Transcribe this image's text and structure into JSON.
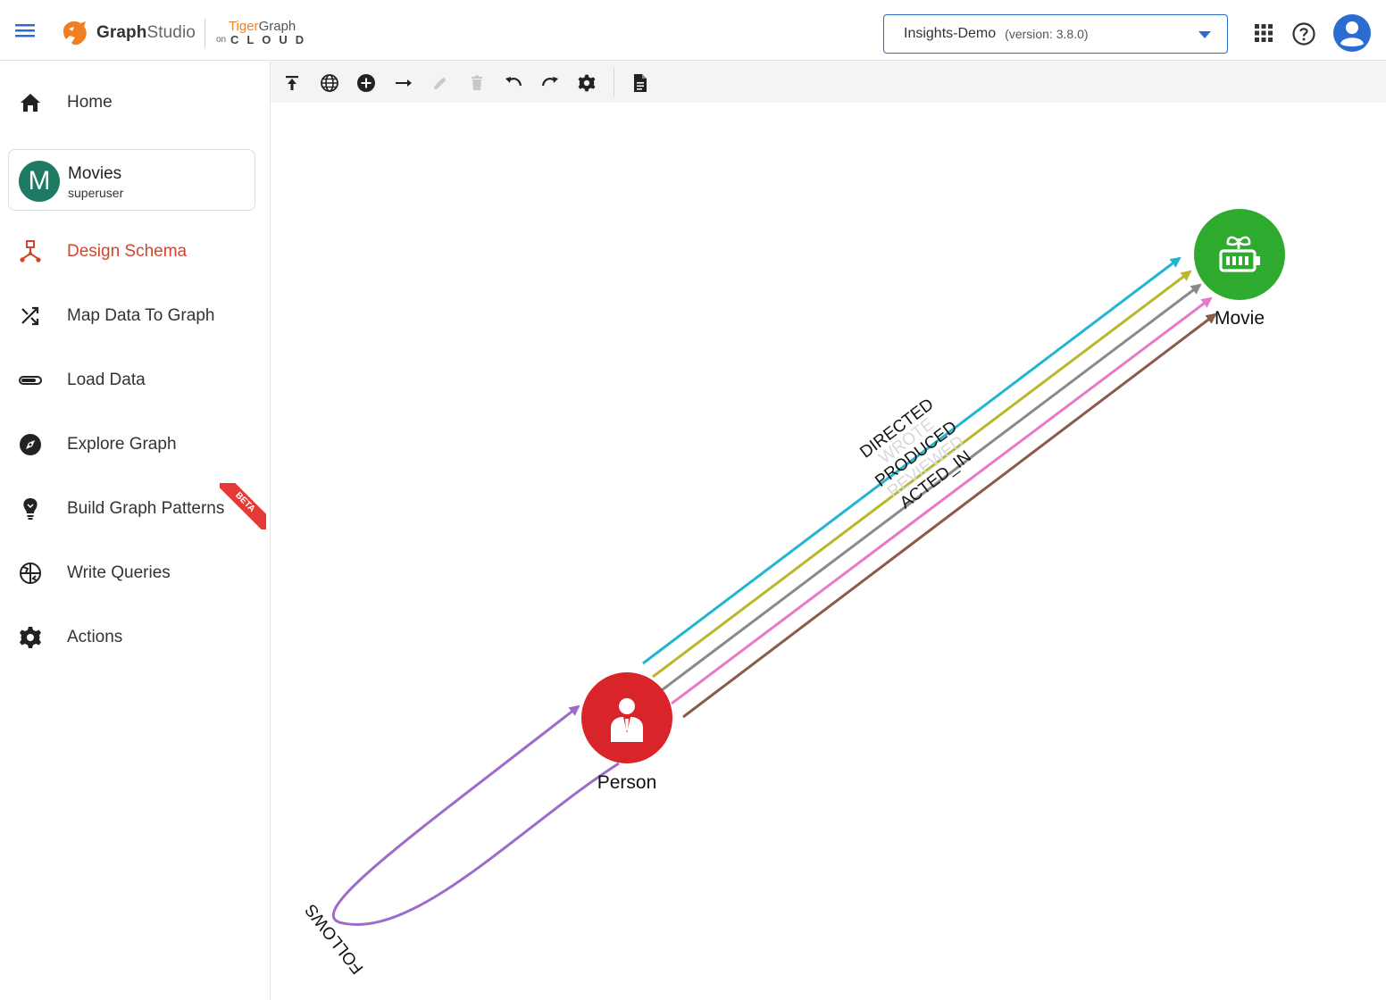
{
  "header": {
    "logo_graph": "Graph",
    "logo_studio": "Studio",
    "logo_tiger": "Tiger",
    "logo_graph2": "Graph",
    "logo_on": "on",
    "logo_cloud": "CLOUD",
    "graph_selector": {
      "name": "Insights-Demo",
      "version": "(version: 3.8.0)"
    },
    "icons": [
      "menu-icon",
      "apps-grid-icon",
      "help-icon",
      "account-icon"
    ]
  },
  "sidebar": {
    "home": "Home",
    "graph_card": {
      "avatar_letter": "M",
      "name": "Movies",
      "role": "superuser"
    },
    "items": [
      {
        "label": "Design Schema",
        "icon": "schema-icon",
        "active": true
      },
      {
        "label": "Map Data To Graph",
        "icon": "shuffle-icon"
      },
      {
        "label": "Load Data",
        "icon": "load-bar-icon"
      },
      {
        "label": "Explore Graph",
        "icon": "compass-icon"
      },
      {
        "label": "Build Graph Patterns",
        "icon": "lightbulb-icon",
        "badge": "BETA"
      },
      {
        "label": "Write Queries",
        "icon": "query-globe-icon"
      },
      {
        "label": "Actions",
        "icon": "gear-icon"
      }
    ]
  },
  "toolbar": {
    "buttons": [
      "publish-schema",
      "global-view",
      "add-vertex",
      "add-edge",
      "edit",
      "delete",
      "undo",
      "redo",
      "settings",
      "document"
    ]
  },
  "schema": {
    "vertices": [
      {
        "name": "Person",
        "color": "#d9252a",
        "icon": "person-icon"
      },
      {
        "name": "Movie",
        "color": "#2eaa2e",
        "icon": "movie-icon"
      }
    ],
    "edges": [
      {
        "name": "DIRECTED",
        "from": "Person",
        "to": "Movie",
        "color": "#21b6cf"
      },
      {
        "name": "WROTE",
        "from": "Person",
        "to": "Movie",
        "color": "#b8b82a"
      },
      {
        "name": "PRODUCED",
        "from": "Person",
        "to": "Movie",
        "color": "#8a8a8a"
      },
      {
        "name": "REVIEWED",
        "from": "Person",
        "to": "Movie",
        "color": "#e57ac8"
      },
      {
        "name": "ACTED_IN",
        "from": "Person",
        "to": "Movie",
        "color": "#8b5a4a"
      },
      {
        "name": "FOLLOWS",
        "from": "Person",
        "to": "Person",
        "color": "#9b6cc9"
      }
    ]
  }
}
